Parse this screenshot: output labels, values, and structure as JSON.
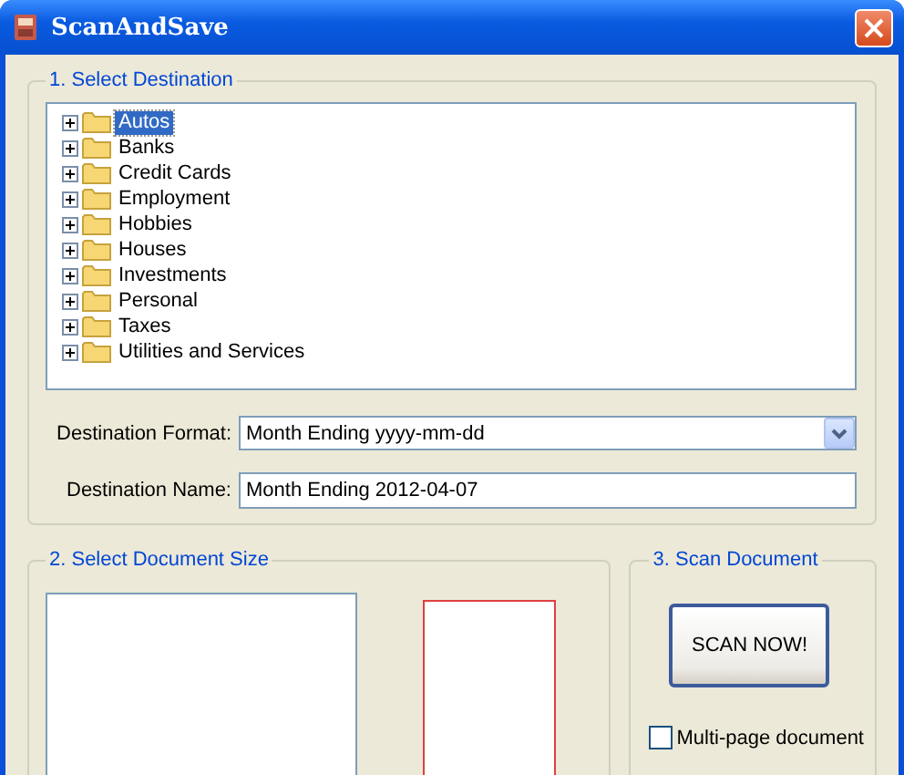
{
  "window": {
    "title": "ScanAndSave"
  },
  "destination_group": {
    "title": "1. Select Destination",
    "tree": [
      {
        "label": "Autos",
        "selected": true,
        "expanded": false
      },
      {
        "label": "Banks",
        "selected": false,
        "expanded": false
      },
      {
        "label": "Credit Cards",
        "selected": false,
        "expanded": false
      },
      {
        "label": "Employment",
        "selected": false,
        "expanded": false
      },
      {
        "label": "Hobbies",
        "selected": false,
        "expanded": false
      },
      {
        "label": "Houses",
        "selected": false,
        "expanded": false
      },
      {
        "label": "Investments",
        "selected": false,
        "expanded": false
      },
      {
        "label": "Personal",
        "selected": false,
        "expanded": false
      },
      {
        "label": "Taxes",
        "selected": false,
        "expanded": false
      },
      {
        "label": "Utilities and Services",
        "selected": false,
        "expanded": false
      }
    ],
    "format": {
      "label": "Destination Format:",
      "value": "Month Ending yyyy-mm-dd"
    },
    "name": {
      "label": "Destination Name:",
      "value": "Month Ending 2012-04-07"
    }
  },
  "size_group": {
    "title": "2. Select Document Size"
  },
  "scan_group": {
    "title": "3. Scan Document",
    "button": "SCAN NOW!",
    "multi_page": {
      "label": "Multi-page document",
      "checked": false
    }
  }
}
